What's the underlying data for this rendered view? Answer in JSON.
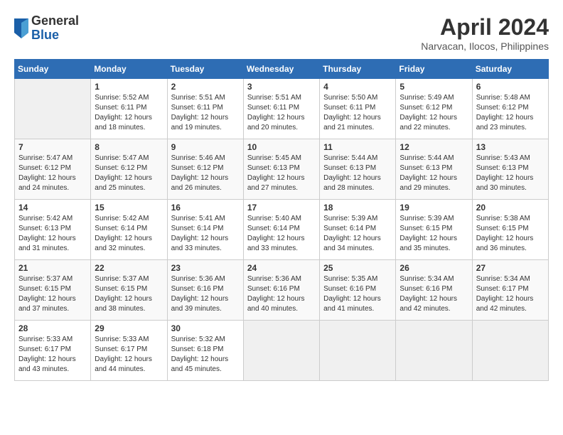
{
  "header": {
    "logo_general": "General",
    "logo_blue": "Blue",
    "month_title": "April 2024",
    "location": "Narvacan, Ilocos, Philippines"
  },
  "weekdays": [
    "Sunday",
    "Monday",
    "Tuesday",
    "Wednesday",
    "Thursday",
    "Friday",
    "Saturday"
  ],
  "weeks": [
    [
      null,
      {
        "day": 1,
        "sunrise": "5:52 AM",
        "sunset": "6:11 PM",
        "daylight": "12 hours and 18 minutes."
      },
      {
        "day": 2,
        "sunrise": "5:51 AM",
        "sunset": "6:11 PM",
        "daylight": "12 hours and 19 minutes."
      },
      {
        "day": 3,
        "sunrise": "5:51 AM",
        "sunset": "6:11 PM",
        "daylight": "12 hours and 20 minutes."
      },
      {
        "day": 4,
        "sunrise": "5:50 AM",
        "sunset": "6:11 PM",
        "daylight": "12 hours and 21 minutes."
      },
      {
        "day": 5,
        "sunrise": "5:49 AM",
        "sunset": "6:12 PM",
        "daylight": "12 hours and 22 minutes."
      },
      {
        "day": 6,
        "sunrise": "5:48 AM",
        "sunset": "6:12 PM",
        "daylight": "12 hours and 23 minutes."
      }
    ],
    [
      {
        "day": 7,
        "sunrise": "5:47 AM",
        "sunset": "6:12 PM",
        "daylight": "12 hours and 24 minutes."
      },
      {
        "day": 8,
        "sunrise": "5:47 AM",
        "sunset": "6:12 PM",
        "daylight": "12 hours and 25 minutes."
      },
      {
        "day": 9,
        "sunrise": "5:46 AM",
        "sunset": "6:12 PM",
        "daylight": "12 hours and 26 minutes."
      },
      {
        "day": 10,
        "sunrise": "5:45 AM",
        "sunset": "6:13 PM",
        "daylight": "12 hours and 27 minutes."
      },
      {
        "day": 11,
        "sunrise": "5:44 AM",
        "sunset": "6:13 PM",
        "daylight": "12 hours and 28 minutes."
      },
      {
        "day": 12,
        "sunrise": "5:44 AM",
        "sunset": "6:13 PM",
        "daylight": "12 hours and 29 minutes."
      },
      {
        "day": 13,
        "sunrise": "5:43 AM",
        "sunset": "6:13 PM",
        "daylight": "12 hours and 30 minutes."
      }
    ],
    [
      {
        "day": 14,
        "sunrise": "5:42 AM",
        "sunset": "6:13 PM",
        "daylight": "12 hours and 31 minutes."
      },
      {
        "day": 15,
        "sunrise": "5:42 AM",
        "sunset": "6:14 PM",
        "daylight": "12 hours and 32 minutes."
      },
      {
        "day": 16,
        "sunrise": "5:41 AM",
        "sunset": "6:14 PM",
        "daylight": "12 hours and 33 minutes."
      },
      {
        "day": 17,
        "sunrise": "5:40 AM",
        "sunset": "6:14 PM",
        "daylight": "12 hours and 33 minutes."
      },
      {
        "day": 18,
        "sunrise": "5:39 AM",
        "sunset": "6:14 PM",
        "daylight": "12 hours and 34 minutes."
      },
      {
        "day": 19,
        "sunrise": "5:39 AM",
        "sunset": "6:15 PM",
        "daylight": "12 hours and 35 minutes."
      },
      {
        "day": 20,
        "sunrise": "5:38 AM",
        "sunset": "6:15 PM",
        "daylight": "12 hours and 36 minutes."
      }
    ],
    [
      {
        "day": 21,
        "sunrise": "5:37 AM",
        "sunset": "6:15 PM",
        "daylight": "12 hours and 37 minutes."
      },
      {
        "day": 22,
        "sunrise": "5:37 AM",
        "sunset": "6:15 PM",
        "daylight": "12 hours and 38 minutes."
      },
      {
        "day": 23,
        "sunrise": "5:36 AM",
        "sunset": "6:16 PM",
        "daylight": "12 hours and 39 minutes."
      },
      {
        "day": 24,
        "sunrise": "5:36 AM",
        "sunset": "6:16 PM",
        "daylight": "12 hours and 40 minutes."
      },
      {
        "day": 25,
        "sunrise": "5:35 AM",
        "sunset": "6:16 PM",
        "daylight": "12 hours and 41 minutes."
      },
      {
        "day": 26,
        "sunrise": "5:34 AM",
        "sunset": "6:16 PM",
        "daylight": "12 hours and 42 minutes."
      },
      {
        "day": 27,
        "sunrise": "5:34 AM",
        "sunset": "6:17 PM",
        "daylight": "12 hours and 42 minutes."
      }
    ],
    [
      {
        "day": 28,
        "sunrise": "5:33 AM",
        "sunset": "6:17 PM",
        "daylight": "12 hours and 43 minutes."
      },
      {
        "day": 29,
        "sunrise": "5:33 AM",
        "sunset": "6:17 PM",
        "daylight": "12 hours and 44 minutes."
      },
      {
        "day": 30,
        "sunrise": "5:32 AM",
        "sunset": "6:18 PM",
        "daylight": "12 hours and 45 minutes."
      },
      null,
      null,
      null,
      null
    ]
  ],
  "labels": {
    "sunrise": "Sunrise:",
    "sunset": "Sunset:",
    "daylight": "Daylight:"
  }
}
